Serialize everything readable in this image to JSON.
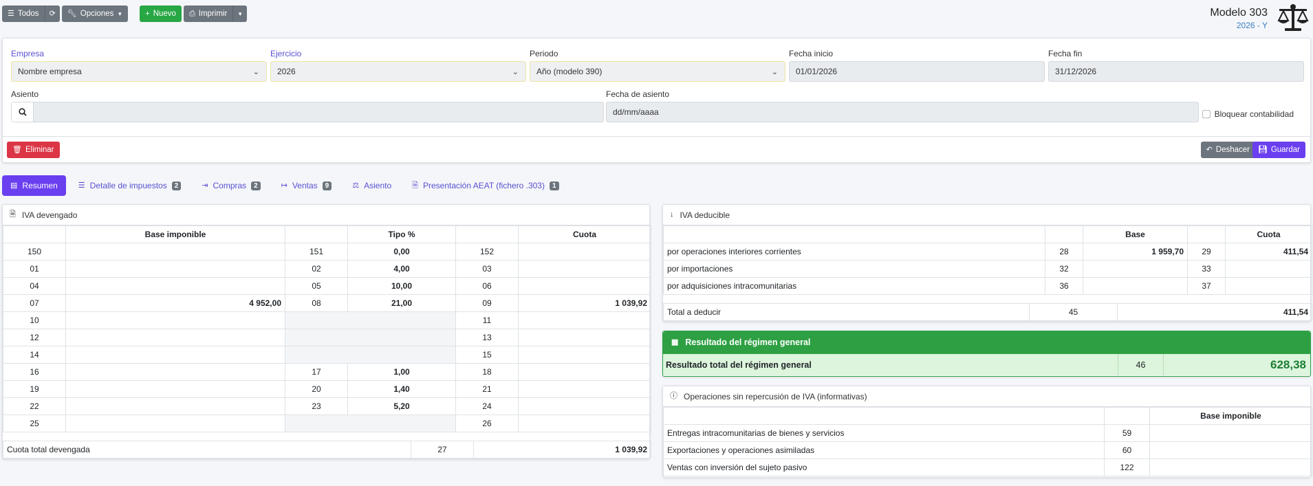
{
  "toolbar": {
    "todos": "Todos",
    "opciones": "Opciones",
    "nuevo": "Nuevo",
    "imprimir": "Imprimir"
  },
  "header": {
    "title": "Modelo 303",
    "subtitle": "2026 - Y"
  },
  "form": {
    "empresa_label": "Empresa",
    "empresa_value": "Nombre empresa",
    "ejercicio_label": "Ejercicio",
    "ejercicio_value": "2026",
    "periodo_label": "Periodo",
    "periodo_value": "Año (modelo 390)",
    "fecha_inicio_label": "Fecha inicio",
    "fecha_inicio_value": "01/01/2026",
    "fecha_fin_label": "Fecha fin",
    "fecha_fin_value": "31/12/2026",
    "asiento_label": "Asiento",
    "asiento_value": "",
    "fecha_asiento_label": "Fecha de asiento",
    "fecha_asiento_placeholder": "dd/mm/aaaa",
    "bloquear_label": "Bloquear contabilidad",
    "eliminar": "Eliminar",
    "deshacer": "Deshacer",
    "guardar": "Guardar"
  },
  "tabs": [
    {
      "label": "Resumen",
      "badge": ""
    },
    {
      "label": "Detalle de impuestos",
      "badge": "2"
    },
    {
      "label": "Compras",
      "badge": "2"
    },
    {
      "label": "Ventas",
      "badge": "9"
    },
    {
      "label": "Asiento",
      "badge": ""
    },
    {
      "label": "Presentación AEAT (fichero .303)",
      "badge": "1"
    }
  ],
  "devengado": {
    "title": "IVA devengado",
    "headers": [
      "Base imponible",
      "Tipo %",
      "Cuota"
    ],
    "rows": [
      [
        "150",
        "",
        "151",
        "0,00",
        "152",
        ""
      ],
      [
        "01",
        "",
        "02",
        "4,00",
        "03",
        ""
      ],
      [
        "04",
        "",
        "05",
        "10,00",
        "06",
        ""
      ],
      [
        "07",
        "4 952,00",
        "08",
        "21,00",
        "09",
        "1 039,92"
      ],
      [
        "10",
        "",
        "",
        "",
        "11",
        ""
      ],
      [
        "12",
        "",
        "",
        "",
        "13",
        ""
      ],
      [
        "14",
        "",
        "",
        "",
        "15",
        ""
      ],
      [
        "16",
        "",
        "17",
        "1,00",
        "18",
        ""
      ],
      [
        "19",
        "",
        "20",
        "1,40",
        "21",
        ""
      ],
      [
        "22",
        "",
        "23",
        "5,20",
        "24",
        ""
      ],
      [
        "25",
        "",
        "",
        "",
        "26",
        ""
      ]
    ],
    "total_label": "Cuota total devengada",
    "total_box": "27",
    "total_value": "1 039,92"
  },
  "deducible": {
    "title": "IVA deducible",
    "headers": [
      "Base",
      "Cuota"
    ],
    "rows": [
      [
        "por operaciones interiores corrientes",
        "28",
        "1 959,70",
        "29",
        "411,54"
      ],
      [
        "por importaciones",
        "32",
        "",
        "33",
        ""
      ],
      [
        "por adquisiciones intracomunitarias",
        "36",
        "",
        "37",
        ""
      ]
    ],
    "total_label": "Total a deducir",
    "total_box": "45",
    "total_value": "411,54"
  },
  "resultado": {
    "title": "Resultado del régimen general",
    "label": "Resultado total del régimen general",
    "box": "46",
    "value": "628,38"
  },
  "operaciones": {
    "title": "Operaciones sin repercusión de IVA (informativas)",
    "header": "Base imponible",
    "rows": [
      [
        "Entregas intracomunitarias de bienes y servicios",
        "59",
        ""
      ],
      [
        "Exportaciones y operaciones asimiladas",
        "60",
        ""
      ],
      [
        "Ventas con inversión del sujeto pasivo",
        "122",
        ""
      ]
    ]
  },
  "colors": {
    "accent": "#6a3ff0",
    "success": "#2ea043",
    "danger": "#dc3545"
  }
}
